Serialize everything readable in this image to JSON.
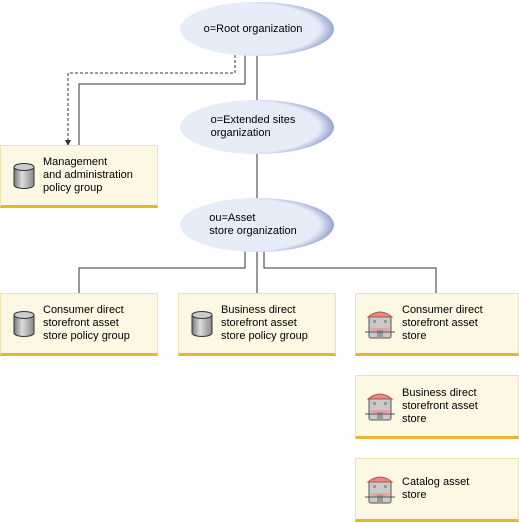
{
  "nodes": {
    "root": "o=Root organization",
    "extended_l1": "o=Extended sites",
    "extended_l2": "organization",
    "asset_l1": "ou=Asset",
    "asset_l2": "store organization",
    "mgmt": [
      "Management",
      "and administration",
      "policy group"
    ],
    "consumer_policy": [
      "Consumer direct",
      "storefront asset",
      "store policy group"
    ],
    "business_policy": [
      "Business direct",
      "storefront asset",
      "store policy group"
    ],
    "consumer_store": [
      "Consumer direct",
      "storefront asset",
      "store"
    ],
    "business_store": [
      "Business direct",
      "storefront asset",
      "store"
    ],
    "catalog_store": [
      "Catalog asset",
      "store"
    ]
  },
  "colors": {
    "ellipse_fill": "#e6ecf8",
    "ellipse_edge": "#7487c0",
    "box_fill": "#fdf8e4",
    "box_accent": "#e7b62c"
  },
  "icons": {
    "policy_group": "database-cylinder-icon",
    "store": "storefront-building-icon"
  }
}
